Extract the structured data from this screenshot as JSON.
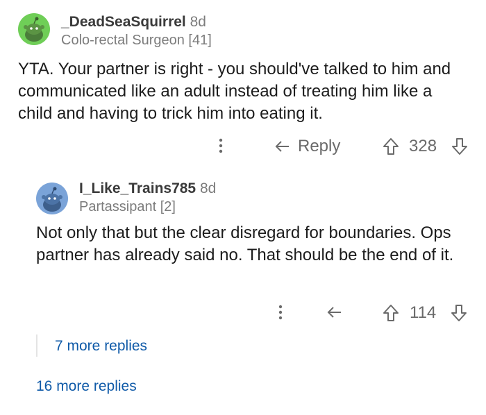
{
  "comments": [
    {
      "username": "_DeadSeaSquirrel",
      "age": "8d",
      "flair": "Colo-rectal Surgeon [41]",
      "body": "YTA. Your partner is right - you should've talked to him and communicated like an adult instead of treating him like a child and having to trick him into eating it.",
      "reply_label": "Reply",
      "score": "328",
      "avatar_color": "#6fce57"
    },
    {
      "username": "I_Like_Trains785",
      "age": "8d",
      "flair": "Partassipant [2]",
      "body": "Not only that but the clear disregard for boundaries. Ops partner has already said no. That should be the end of it.",
      "score": "114",
      "avatar_color": "#7aa3d8"
    }
  ],
  "more_replies_nested": "7 more replies",
  "more_replies": "16 more replies",
  "colors": {
    "link": "#0f5aa8",
    "text": "#1c1c1c",
    "muted": "#7c7c7c"
  }
}
